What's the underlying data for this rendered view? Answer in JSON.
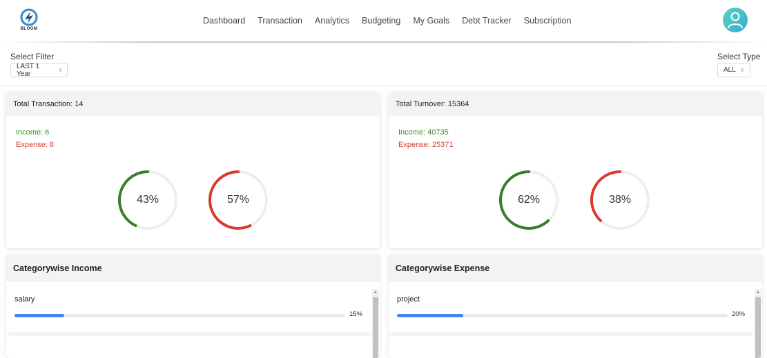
{
  "brand": {
    "logo_text": "BLOOM"
  },
  "nav": {
    "items": [
      "Dashboard",
      "Transaction",
      "Analytics",
      "Budgeting",
      "My Goals",
      "Debt Tracker",
      "Subscription"
    ]
  },
  "filters": {
    "filter_label": "Select Filter",
    "filter_value": "LAST 1 Year",
    "type_label": "Select Type",
    "type_value": "ALL"
  },
  "transactions_card": {
    "title": "Total Transaction: 14",
    "income": "Income: 6",
    "expense": "Expense: 8",
    "income_pct": 43,
    "expense_pct": 57,
    "income_pct_label": "43%",
    "expense_pct_label": "57%"
  },
  "turnover_card": {
    "title": "Total Turnover: 15364",
    "income": "Income: 40735",
    "expense": "Expense: 25371",
    "income_pct": 62,
    "expense_pct": 38,
    "income_pct_label": "62%",
    "expense_pct_label": "38%"
  },
  "category_income": {
    "title": "Categorywise Income",
    "items": [
      {
        "name": "salary",
        "pct": 15,
        "pct_label": "15%"
      }
    ]
  },
  "category_expense": {
    "title": "Categorywise Expense",
    "items": [
      {
        "name": "project",
        "pct": 20,
        "pct_label": "20%"
      }
    ]
  },
  "colors": {
    "income": "#3a7d2c",
    "expense": "#d93a2b",
    "track": "#eeeeee",
    "bar": "#4285f4"
  },
  "icons": {
    "user": "user-icon",
    "chevron": "chevron-down-icon",
    "logo": "bloom-logo-icon"
  }
}
